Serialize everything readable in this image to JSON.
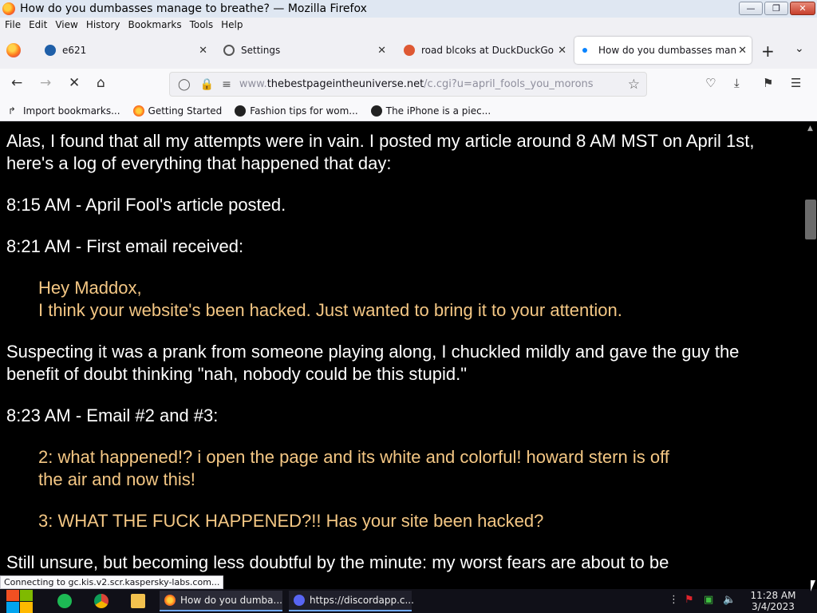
{
  "window": {
    "title": "How do you dumbasses manage to breathe? — Mozilla Firefox"
  },
  "menu": [
    "File",
    "Edit",
    "View",
    "History",
    "Bookmarks",
    "Tools",
    "Help"
  ],
  "tabs": [
    {
      "label": "e621",
      "favicon_color": "#1f5fa8"
    },
    {
      "label": "Settings",
      "favicon_color": "#555555"
    },
    {
      "label": "road blcoks at DuckDuckGo",
      "favicon_color": "#de5833"
    },
    {
      "label": "How do you dumbasses manag",
      "favicon_color": "#0a84ff",
      "active": true
    }
  ],
  "address": {
    "host_prefix": "www.",
    "domain": "thebestpageintheuniverse.net",
    "rest": "/c.cgi?u=april_fools_you_morons"
  },
  "bookmarks": [
    {
      "label": "Import bookmarks..."
    },
    {
      "label": "Getting Started"
    },
    {
      "label": "Fashion tips for wom..."
    },
    {
      "label": "The iPhone is a piec..."
    }
  ],
  "content": {
    "p1": "Alas, I found that all my attempts were in vain. I posted my article around 8 AM MST on April 1st, here's a log of everything that happened that day:",
    "p2": "8:15 AM - April Fool's article posted.",
    "p3": "8:21 AM - First email received:",
    "q1a": "Hey Maddox,",
    "q1b": "I think your website's been hacked. Just wanted to bring it to your attention.",
    "p4": "Suspecting it was a prank from someone playing along, I chuckled mildly and gave the guy the benefit of doubt thinking \"nah, nobody could be this stupid.\"",
    "p5": "8:23 AM - Email #2 and #3:",
    "q2": "2: what happened!? i open the page and its white and colorful! howard stern is off the air and now this!",
    "q3": "3: WHAT THE FUCK HAPPENED?!! Has your site been hacked?",
    "p6": "Still unsure, but becoming less doubtful by the minute: my worst fears are about to be"
  },
  "status_text": "Connecting to gc.kis.v2.scr.kaspersky-labs.com...",
  "taskbar": {
    "tasks": [
      {
        "label": "How do you dumba..."
      },
      {
        "label": "https://discordapp.c..."
      }
    ],
    "clock_time": "11:28 AM",
    "clock_date": "3/4/2023"
  },
  "colors": {
    "page_background": "#000000",
    "body_text": "#ffffff",
    "quote_text": "#f4c784",
    "taskbar": "#101018"
  }
}
